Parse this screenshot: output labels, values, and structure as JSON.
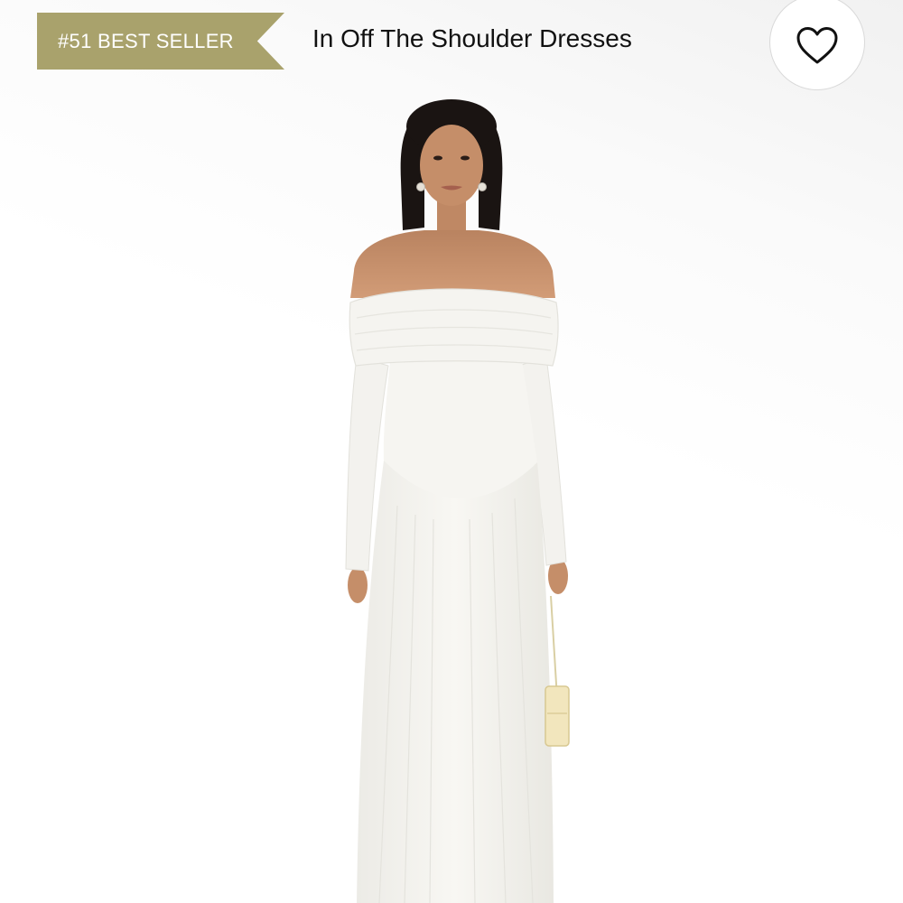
{
  "header": {
    "badge_label": "#51 BEST SELLER",
    "collection_title": "In Off The Shoulder Dresses",
    "wishlist_icon": "heart-outline-icon"
  },
  "product_image": {
    "description_icon": "product-photo",
    "dress_color": "#f6f5f1"
  },
  "colors": {
    "badge": "#a9a26c",
    "heart_stroke": "#111111",
    "dress": "#f6f5f1",
    "skin": "#c9906a",
    "hair": "#1a1412"
  }
}
